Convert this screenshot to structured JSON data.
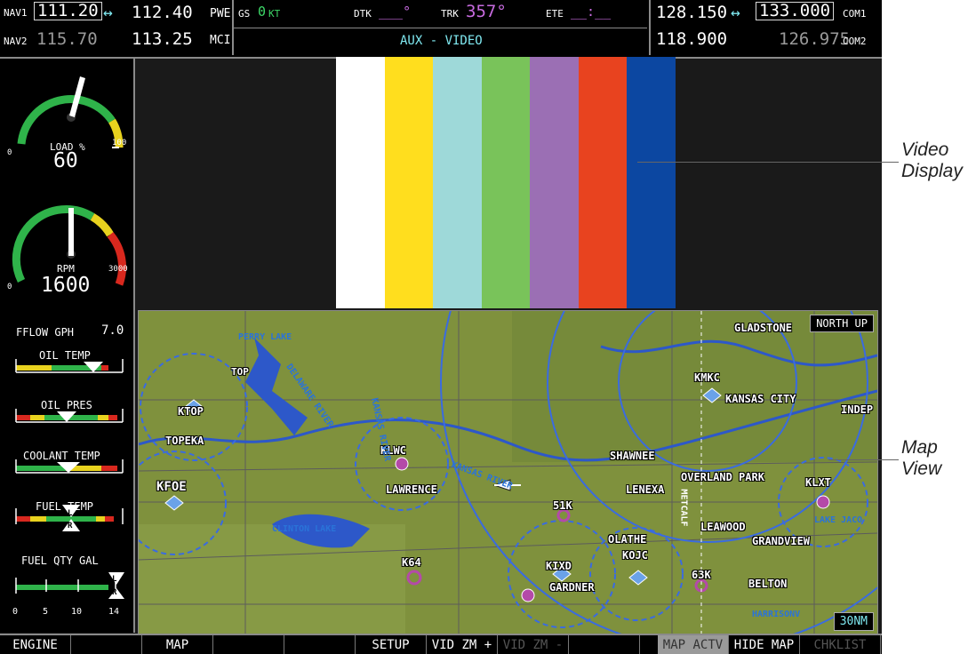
{
  "topbar": {
    "nav1_label": "NAV1",
    "nav1_active": "111.20",
    "swap_arrow": "↔",
    "nav1_standby": "112.40",
    "nav1_ident": "PWE",
    "nav2_label": "NAV2",
    "nav2_active": "115.70",
    "nav2_standby": "113.25",
    "nav2_ident": "MCI",
    "gs_label": "GS",
    "gs_value": "0",
    "gs_unit": "KT",
    "dtk_label": "DTK",
    "dtk_value": "___°",
    "trk_label": "TRK",
    "trk_value": "357°",
    "ete_label": "ETE",
    "ete_value": "__:__",
    "page_title": "AUX - VIDEO",
    "com1_active": "128.150",
    "com1_standby": "133.000",
    "com1_label": "COM1",
    "com2_active": "118.900",
    "com2_standby": "126.975",
    "com2_label": "COM2"
  },
  "eis": {
    "load_label": "LOAD %",
    "load_value": "60",
    "load_min": "0",
    "load_max": "100",
    "load_fraction": 0.6,
    "rpm_label": "RPM",
    "rpm_value": "1600",
    "rpm_min": "0",
    "rpm_max": "3000",
    "rpm_fraction": 0.53,
    "fflow_label": "FFLOW GPH",
    "fflow_value": "7.0",
    "oil_temp_label": "OIL TEMP",
    "oil_pres_label": "OIL PRES",
    "coolant_label": "COOLANT TEMP",
    "fuel_temp_label": "FUEL TEMP",
    "fuel_qty_label": "FUEL QTY GAL",
    "fuel_ticks": [
      "0",
      "5",
      "10",
      "14"
    ],
    "l_marker": "L",
    "r_marker": "R"
  },
  "video": {
    "colors": [
      "#ffffff",
      "#ffde1e",
      "#9ed9d9",
      "#79c35a",
      "#9b6fb4",
      "#e8431f",
      "#0c47a1"
    ]
  },
  "map": {
    "orientation": "NORTH UP",
    "range": "30NM",
    "airports": [
      {
        "id": "KTOP"
      },
      {
        "id": "KFOE"
      },
      {
        "id": "KLWC"
      },
      {
        "id": "51K"
      },
      {
        "id": "KMKC"
      },
      {
        "id": "KLXT"
      },
      {
        "id": "K64"
      },
      {
        "id": "KIXD"
      },
      {
        "id": "KOJC"
      },
      {
        "id": "63K"
      }
    ],
    "cities": [
      "TOPEKA",
      "LAWRENCE",
      "SHAWNEE",
      "LENEXA",
      "OVERLAND PARK",
      "OLATHE",
      "GARDNER",
      "LEAWOOD",
      "GRANDVIEW",
      "BELTON",
      "KANSAS CITY",
      "GLADSTONE",
      "INDEP"
    ],
    "lakes": [
      "PERRY LAKE",
      "CLINTON LAKE",
      "LAKE JACO",
      "HARRISONV"
    ],
    "small_labels": [
      "TOP",
      "DELAWARE RIVER",
      "KANSAS RIVER",
      "KANSAS RIVER",
      "METCALF"
    ],
    "highways": [
      "335",
      "59",
      "70",
      "435",
      "35",
      "29",
      "210",
      "71",
      "7",
      "10",
      "24",
      "24",
      "24",
      "12",
      "16",
      "18",
      "21",
      "15",
      "6",
      "8",
      "9",
      "12",
      "75",
      "56",
      "291",
      "40",
      "50",
      "21",
      "59"
    ]
  },
  "softkeys": [
    {
      "label": "ENGINE",
      "state": "normal"
    },
    {
      "label": "",
      "state": "normal"
    },
    {
      "label": "MAP",
      "state": "normal"
    },
    {
      "label": "",
      "state": "normal"
    },
    {
      "label": "",
      "state": "normal"
    },
    {
      "label": "SETUP",
      "state": "normal"
    },
    {
      "label": "VID ZM +",
      "state": "normal"
    },
    {
      "label": "VID ZM -",
      "state": "dim"
    },
    {
      "label": "",
      "state": "normal"
    },
    {
      "label": "MAP ACTV",
      "state": "active"
    },
    {
      "label": "HIDE MAP",
      "state": "normal"
    },
    {
      "label": "CHKLIST",
      "state": "dim"
    }
  ],
  "callouts": {
    "video_line1": "Video",
    "video_line2": "Display",
    "map_line1": "Map",
    "map_line2": "View"
  }
}
